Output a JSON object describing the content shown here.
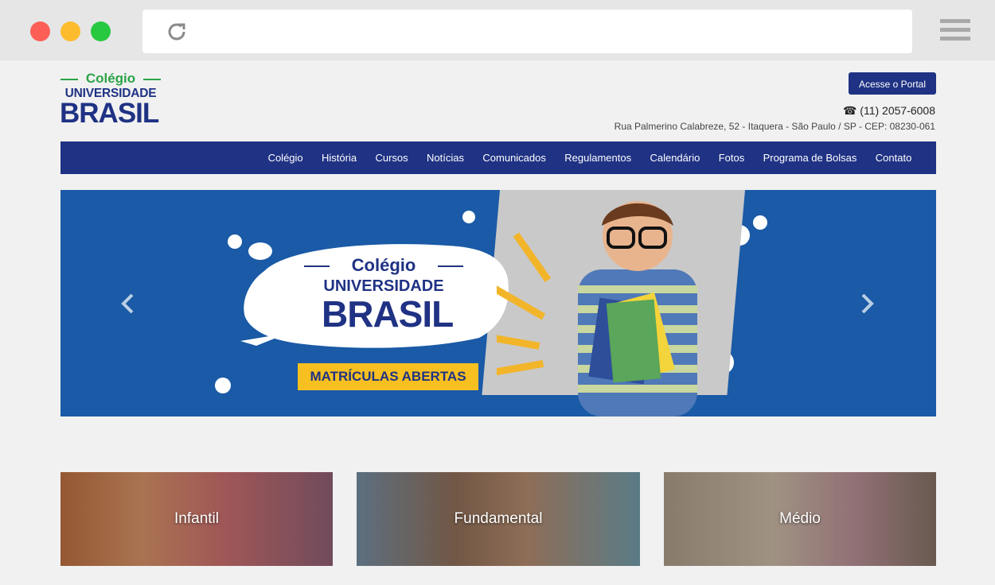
{
  "browser": {
    "reload_icon": "reload-icon",
    "menu_icon": "hamburger-menu-icon"
  },
  "header": {
    "logo": {
      "line1": "Colégio",
      "line2": "UNIVERSIDADE",
      "line3": "BRASIL"
    },
    "portal_button": "Acesse o Portal",
    "phone": "(11) 2057-6008",
    "address": "Rua Palmerino Calabreze, 52 - Itaquera - São Paulo / SP - CEP: 08230-061"
  },
  "nav": {
    "items": [
      "Colégio",
      "História",
      "Cursos",
      "Notícias",
      "Comunicados",
      "Regulamentos",
      "Calendário",
      "Fotos",
      "Programa de Bolsas",
      "Contato"
    ]
  },
  "banner": {
    "logo_line1": "Colégio",
    "logo_line2": "UNIVERSIDADE",
    "logo_line3": "BRASIL",
    "badge": "MATRÍCULAS ABERTAS"
  },
  "cards": [
    {
      "label": "Infantil"
    },
    {
      "label": "Fundamental"
    },
    {
      "label": "Médio"
    }
  ],
  "colors": {
    "brand_blue": "#1f3284",
    "brand_green": "#2ca347",
    "banner_blue": "#1a5aa6",
    "badge_yellow": "#f7c020"
  }
}
